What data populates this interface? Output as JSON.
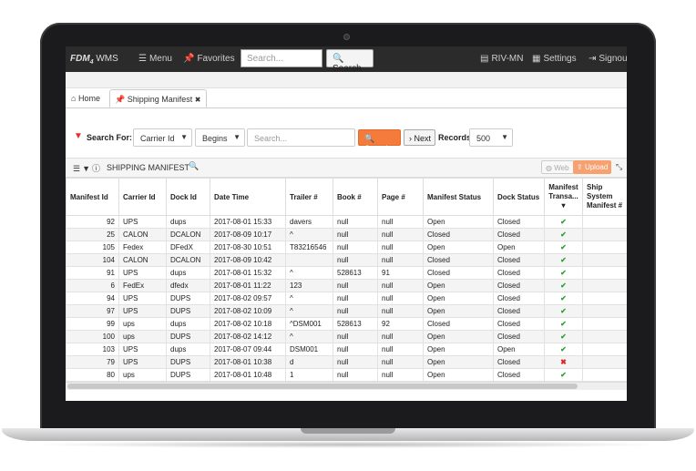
{
  "navbar": {
    "brand": "FDM",
    "brand_sub": "4",
    "brand_suffix": " WMS",
    "menu": "Menu",
    "favorites": "Favorites",
    "search_placeholder": "Search...",
    "search_button": "Search",
    "location": "RIV-MN",
    "settings": "Settings",
    "signout": "Signout"
  },
  "tabs": {
    "home": "Home",
    "active": "Shipping Manifest",
    "close": "✖"
  },
  "search": {
    "label": "Search For:",
    "field": "Carrier Id",
    "operator": "Begins",
    "placeholder": "Search...",
    "search_button": "Search",
    "next_button": "Next",
    "records_label": "Records:",
    "records_value": "500"
  },
  "panel": {
    "title": "SHIPPING MANIFEST",
    "web_button": "Web",
    "upload_button": "Upload"
  },
  "table": {
    "columns": [
      "Manifest Id",
      "Carrier Id",
      "Dock Id",
      "Date Time",
      "Trailer #",
      "Book #",
      "Page #",
      "Manifest Status",
      "Dock Status",
      "Manifest Transa...",
      "Ship System Manifest #"
    ],
    "rows": [
      [
        "92",
        "UPS",
        "dups",
        "2017-08-01 15:33",
        "davers",
        "null",
        "null",
        "Open",
        "Closed",
        "check",
        ""
      ],
      [
        "25",
        "CALON",
        "DCALON",
        "2017-08-09 10:17",
        "^",
        "null",
        "null",
        "Closed",
        "Closed",
        "check",
        ""
      ],
      [
        "105",
        "Fedex",
        "DFedX",
        "2017-08-30 10:51",
        "T83216546",
        "null",
        "null",
        "Open",
        "Open",
        "check",
        ""
      ],
      [
        "104",
        "CALON",
        "DCALON",
        "2017-08-09 10:42",
        "",
        "null",
        "null",
        "Closed",
        "Closed",
        "check",
        ""
      ],
      [
        "91",
        "UPS",
        "dups",
        "2017-08-01 15:32",
        "^",
        "528613",
        "91",
        "Closed",
        "Closed",
        "check",
        ""
      ],
      [
        "6",
        "FedEx",
        "dfedx",
        "2017-08-01 11:22",
        "123",
        "null",
        "null",
        "Open",
        "Closed",
        "check",
        ""
      ],
      [
        "94",
        "UPS",
        "DUPS",
        "2017-08-02 09:57",
        "^",
        "null",
        "null",
        "Open",
        "Closed",
        "check",
        ""
      ],
      [
        "97",
        "UPS",
        "DUPS",
        "2017-08-02 10:09",
        "^",
        "null",
        "null",
        "Open",
        "Closed",
        "check",
        ""
      ],
      [
        "99",
        "ups",
        "dups",
        "2017-08-02 10:18",
        "^DSM001",
        "528613",
        "92",
        "Closed",
        "Closed",
        "check",
        ""
      ],
      [
        "100",
        "ups",
        "DUPS",
        "2017-08-02 14:12",
        "^",
        "null",
        "null",
        "Open",
        "Closed",
        "check",
        ""
      ],
      [
        "103",
        "UPS",
        "dups",
        "2017-08-07 09:44",
        "DSM001",
        "null",
        "null",
        "Open",
        "Open",
        "check",
        ""
      ],
      [
        "79",
        "UPS",
        "DUPS",
        "2017-08-01 10:38",
        "d",
        "null",
        "null",
        "Open",
        "Closed",
        "x",
        ""
      ],
      [
        "80",
        "ups",
        "DUPS",
        "2017-08-01 10:48",
        "1",
        "null",
        "null",
        "Open",
        "Closed",
        "check",
        ""
      ]
    ]
  },
  "colors": {
    "accent": "#f57b3a",
    "navbar": "#2b2b2b",
    "check": "#2e9e3a",
    "cross": "#d9262a"
  }
}
